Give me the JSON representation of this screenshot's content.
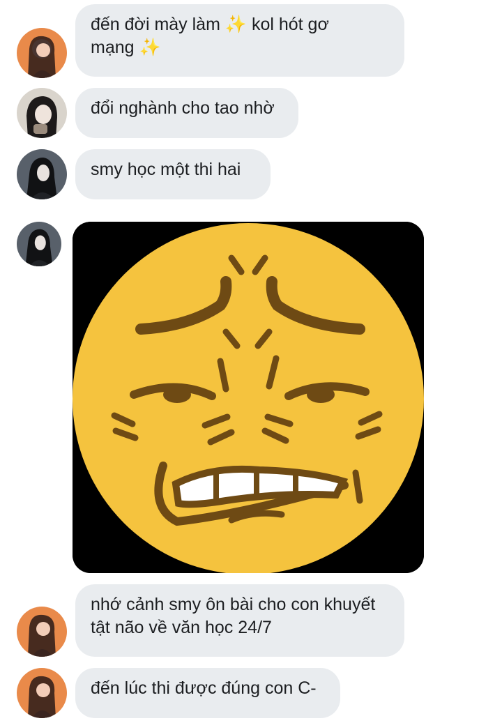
{
  "messages": [
    {
      "text_before": "đến đời mày làm ",
      "sparkle1": "✨",
      "text_middle": " kol hót gơ\nmạng ",
      "sparkle2": "✨"
    },
    {
      "text": "đổi nghành cho tao nhờ"
    },
    {
      "text": "smy học một thi hai"
    },
    {
      "image": "angry-face-emoji-image"
    },
    {
      "text": "nhớ cảnh smy ôn bài cho con khuyết\ntật não về văn học 24/7"
    },
    {
      "text": "đến lúc thi được đúng con C-"
    }
  ],
  "colors": {
    "bubble_bg": "#e9ecef",
    "text": "#1c1e21",
    "emoji_face": "#f5c33e",
    "emoji_feature": "#6e4a14"
  }
}
